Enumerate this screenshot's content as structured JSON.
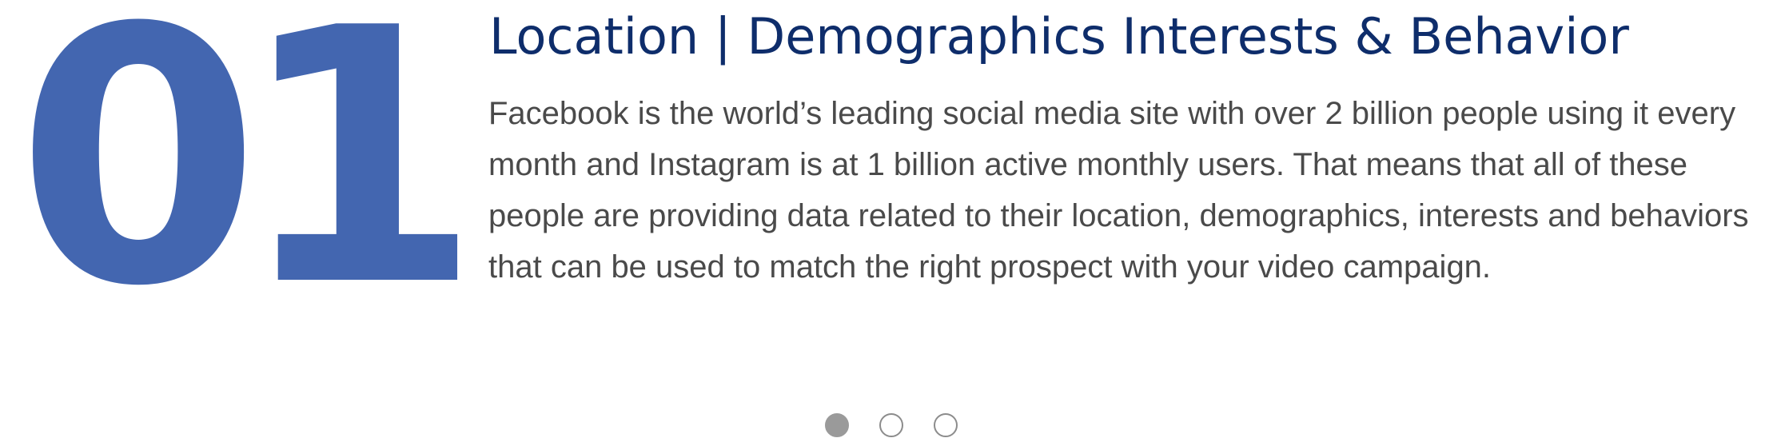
{
  "slide": {
    "number": "01",
    "title": "Location | Demographics Interests & Behavior",
    "body": "Facebook is the world’s leading social media site with over 2 billion people using it every month and Instagram is at 1 billion active monthly users. That means that all of these people are providing data related to their location, demographics, interests and behaviors that can be used to match the right prospect with your video campaign."
  },
  "pagination": {
    "total": 3,
    "active_index": 0
  },
  "colors": {
    "accent": "#4366B0",
    "title": "#0E2D6B",
    "body": "#4a4a4a",
    "dot_active": "#9a9a9a"
  }
}
